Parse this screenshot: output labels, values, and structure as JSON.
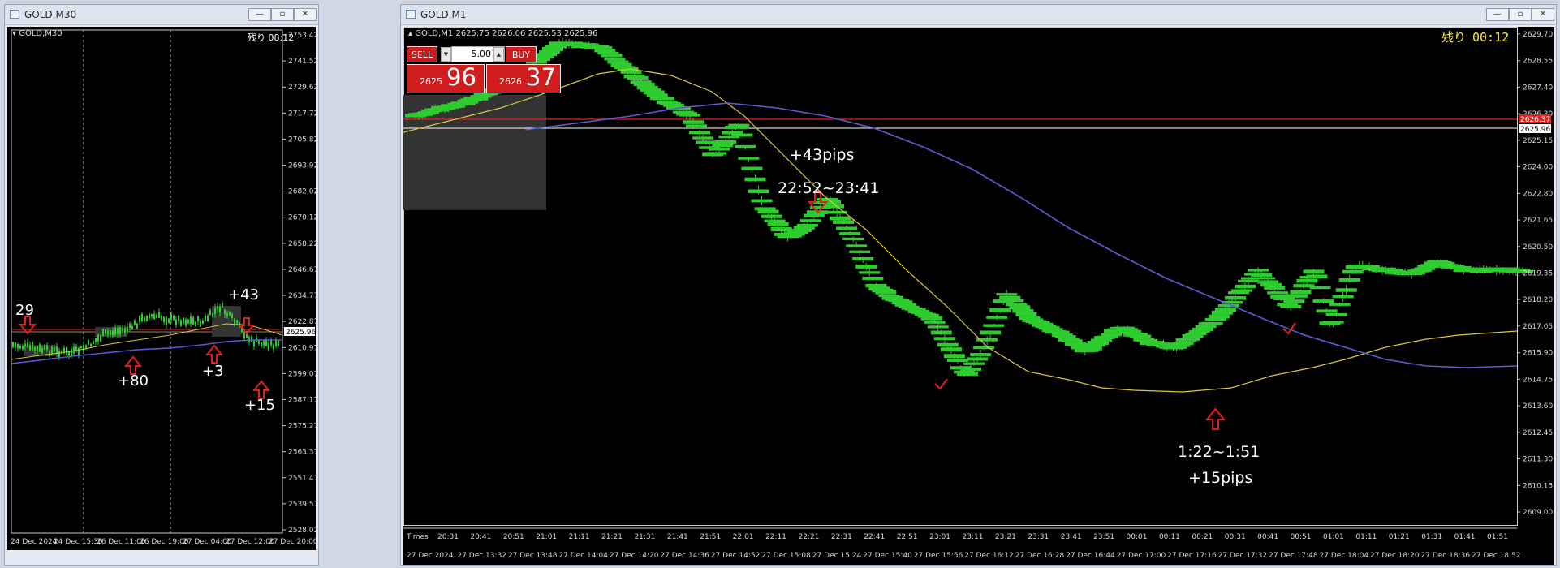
{
  "left_window": {
    "title": "GOLD,M30",
    "chart_label": "GOLD,M30",
    "countdown": "残り 08:12",
    "price_tag": "2625.96",
    "y_ticks": [
      "2753.42",
      "2741.52",
      "2729.62",
      "2717.72",
      "2705.82",
      "2693.92",
      "2682.02",
      "2670.12",
      "2658.22",
      "2646.67",
      "2634.77",
      "2622.87",
      "2610.97",
      "2599.07",
      "2587.17",
      "2575.27",
      "2563.37",
      "2551.47",
      "2539.57",
      "2528.02"
    ],
    "x_ticks": [
      "24 Dec 2024",
      "24 Dec 15:30",
      "26 Dec 11:00",
      "26 Dec 19:00",
      "27 Dec 04:00",
      "27 Dec 12:00",
      "27 Dec 20:00"
    ],
    "annotations": {
      "a1": "29",
      "a2": "+43",
      "a3": "+80",
      "a4": "+3",
      "a5": "+15"
    }
  },
  "right_window": {
    "title": "GOLD,M1",
    "chart_label": "GOLD,M1  2625.75 2626.06 2625.53 2625.96",
    "countdown_label": "残り",
    "countdown_value": "00:12",
    "trade_panel": {
      "sell_label": "SELL",
      "buy_label": "BUY",
      "lot_value": "5.00",
      "sell_small": "2625",
      "sell_big": "96",
      "buy_small": "2626",
      "buy_big": "37"
    },
    "price_tags": {
      "red": "2626.37",
      "white": "2625.96"
    },
    "y_ticks": [
      "2629.70",
      "2628.55",
      "2627.40",
      "2626.30",
      "2625.15",
      "2624.00",
      "2622.80",
      "2621.65",
      "2620.50",
      "2619.35",
      "2618.20",
      "2617.05",
      "2615.90",
      "2614.75",
      "2613.60",
      "2612.45",
      "2611.30",
      "2610.15",
      "2609.00"
    ],
    "time_labels": [
      "20:31",
      "20:41",
      "20:51",
      "21:01",
      "21:11",
      "21:21",
      "21:31",
      "21:41",
      "21:51",
      "22:01",
      "22:11",
      "22:21",
      "22:31",
      "22:41",
      "22:51",
      "23:01",
      "23:11",
      "23:21",
      "23:31",
      "23:41",
      "23:51",
      "00:01",
      "00:11",
      "00:21",
      "00:31",
      "00:41",
      "00:51",
      "01:01",
      "01:11",
      "01:21",
      "01:31",
      "01:41",
      "01:51"
    ],
    "times_label": "Times",
    "x_ticks": [
      "27 Dec 2024",
      "27 Dec 13:32",
      "27 Dec 13:48",
      "27 Dec 14:04",
      "27 Dec 14:20",
      "27 Dec 14:36",
      "27 Dec 14:52",
      "27 Dec 15:08",
      "27 Dec 15:24",
      "27 Dec 15:40",
      "27 Dec 15:56",
      "27 Dec 16:12",
      "27 Dec 16:28",
      "27 Dec 16:44",
      "27 Dec 17:00",
      "27 Dec 17:16",
      "27 Dec 17:32",
      "27 Dec 17:48",
      "27 Dec 18:04",
      "27 Dec 18:20",
      "27 Dec 18:36",
      "27 Dec 18:52"
    ],
    "annotations": {
      "pips1": "+43pips",
      "range1": "22:52~23:41",
      "range2": "1:22~1:51",
      "pips2": "+15pips"
    }
  },
  "colors": {
    "candle": "#2ecc2e",
    "ma_fast": "#d8c640",
    "ma_slow": "#5b5bd6",
    "arrow": "#e02020",
    "price_line_red": "#e02020"
  }
}
